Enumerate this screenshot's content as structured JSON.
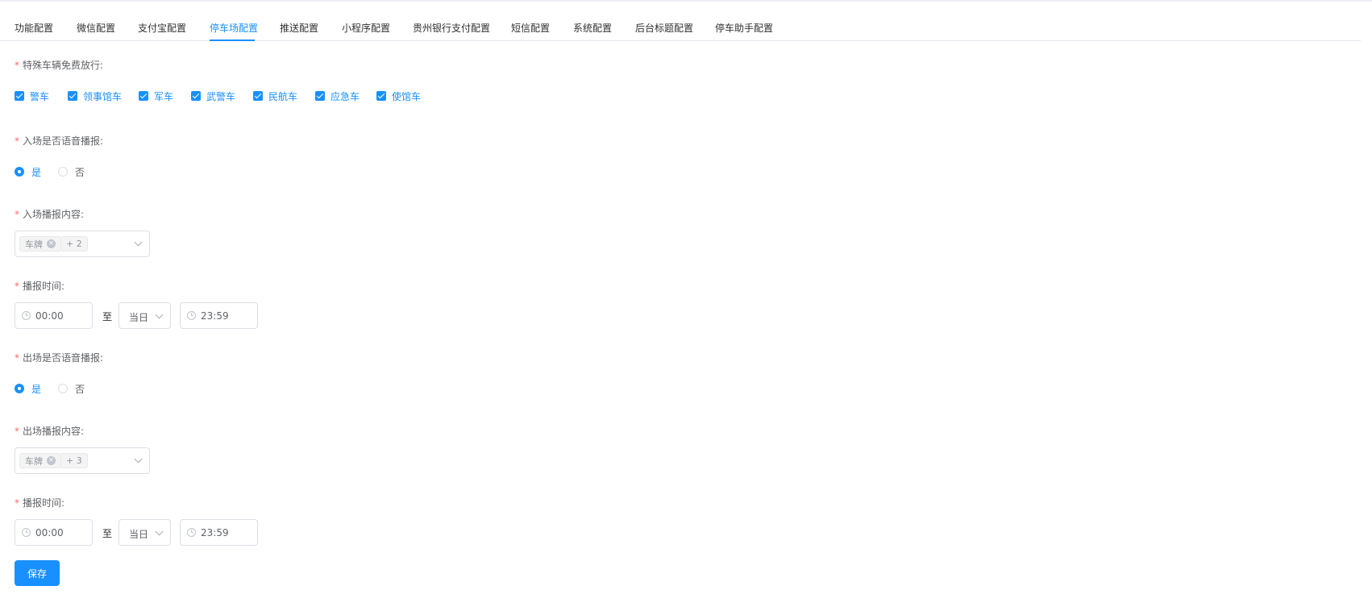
{
  "tabs": [
    {
      "label": "功能配置"
    },
    {
      "label": "微信配置"
    },
    {
      "label": "支付宝配置"
    },
    {
      "label": "停车场配置"
    },
    {
      "label": "推送配置"
    },
    {
      "label": "小程序配置"
    },
    {
      "label": "贵州银行支付配置"
    },
    {
      "label": "短信配置"
    },
    {
      "label": "系统配置"
    },
    {
      "label": "后台标题配置"
    },
    {
      "label": "停车助手配置"
    }
  ],
  "active_tab": "停车场配置",
  "accent_color": "#1890ff",
  "required_mark": "*",
  "special_vehicles": {
    "label": "特殊车辆免费放行:",
    "options": [
      {
        "label": "警车",
        "checked": true
      },
      {
        "label": "领事馆车",
        "checked": true
      },
      {
        "label": "军车",
        "checked": true
      },
      {
        "label": "武警车",
        "checked": true
      },
      {
        "label": "民航车",
        "checked": true
      },
      {
        "label": "应急车",
        "checked": true
      },
      {
        "label": "使馆车",
        "checked": true
      }
    ]
  },
  "entry_voice": {
    "label": "入场是否语音播报:",
    "options": [
      {
        "label": "是",
        "selected": true
      },
      {
        "label": "否",
        "selected": false
      }
    ]
  },
  "entry_content": {
    "label": "入场播报内容:",
    "tag": "车牌",
    "more": "+ 2"
  },
  "entry_time": {
    "label": "播报时间:",
    "start": "00:00",
    "separator": "至",
    "day": "当日",
    "end": "23:59"
  },
  "exit_voice": {
    "label": "出场是否语音播报:",
    "options": [
      {
        "label": "是",
        "selected": true
      },
      {
        "label": "否",
        "selected": false
      }
    ]
  },
  "exit_content": {
    "label": "出场播报内容:",
    "tag": "车牌",
    "more": "+ 3"
  },
  "exit_time": {
    "label": "播报时间:",
    "start": "00:00",
    "separator": "至",
    "day": "当日",
    "end": "23:59"
  },
  "save_label": "保存"
}
